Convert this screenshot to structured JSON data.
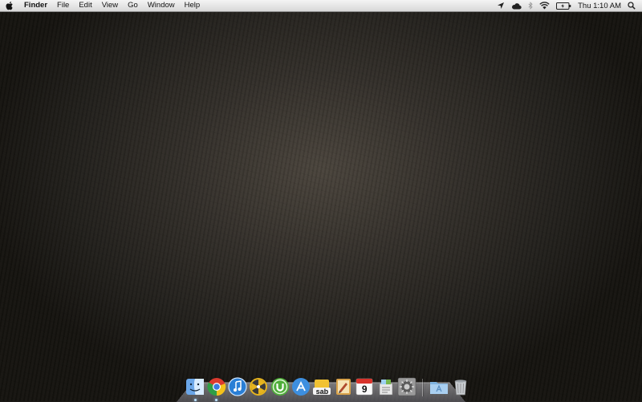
{
  "menubar": {
    "app_name": "Finder",
    "menus": [
      "File",
      "Edit",
      "View",
      "Go",
      "Window",
      "Help"
    ],
    "clock": "Thu 1:10 AM",
    "status_icons": [
      "location-icon",
      "cloud-icon",
      "bluetooth-icon",
      "wifi-icon",
      "battery-icon",
      "spotlight-search-icon"
    ]
  },
  "dock": {
    "items": [
      {
        "name": "finder",
        "icon": "finder-icon",
        "running": true
      },
      {
        "name": "chrome",
        "icon": "chrome-icon",
        "running": true
      },
      {
        "name": "itunes",
        "icon": "itunes-icon",
        "running": false
      },
      {
        "name": "transmission",
        "icon": "transmission-icon",
        "running": false
      },
      {
        "name": "utorrent",
        "icon": "utorrent-icon",
        "running": false
      },
      {
        "name": "app-store",
        "icon": "app-store-icon",
        "running": false
      },
      {
        "name": "sabnzbd",
        "icon": "sabnzbd-icon",
        "label": "sab",
        "running": false
      },
      {
        "name": "script-editor",
        "icon": "script-editor-icon",
        "running": false
      },
      {
        "name": "ical",
        "icon": "calendar-icon",
        "label": "9",
        "running": false
      },
      {
        "name": "preview",
        "icon": "preview-icon",
        "running": false
      },
      {
        "name": "system-preferences",
        "icon": "system-preferences-icon",
        "running": false
      },
      {
        "name": "applications-folder",
        "icon": "applications-folder-icon",
        "running": false
      },
      {
        "name": "trash",
        "icon": "trash-icon",
        "running": false
      }
    ]
  },
  "colors": {
    "menubar": "#e6e6e6",
    "desktop": "#2b2723"
  }
}
